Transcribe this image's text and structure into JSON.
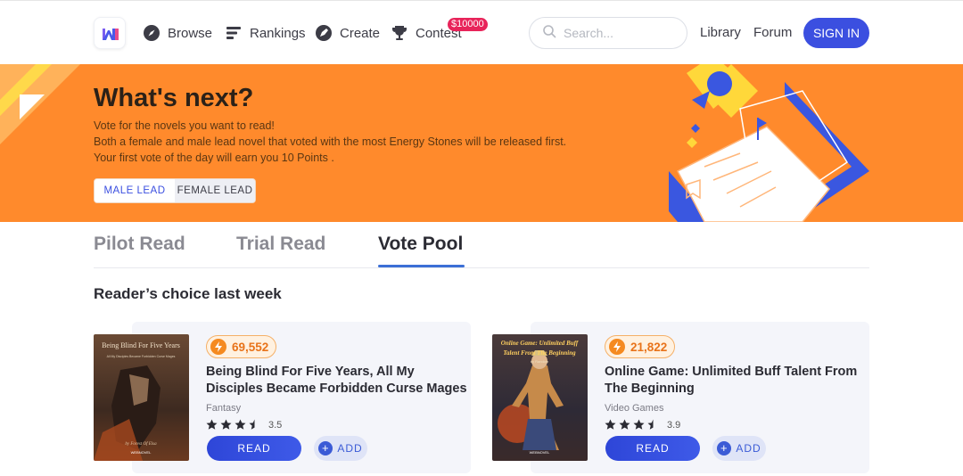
{
  "nav": {
    "browse": "Browse",
    "rankings": "Rankings",
    "create": "Create",
    "contest": "Contest",
    "contest_prize": "$10000",
    "search_placeholder": "Search...",
    "library": "Library",
    "forum": "Forum",
    "signin": "SIGN IN"
  },
  "banner": {
    "title": "What's next?",
    "line1": "Vote for the novels you want to read!",
    "line2": "Both a female and male lead novel that voted with the most Energy Stones will be released first.",
    "line3": "Your first vote of the day will earn you 10 Points .",
    "male_lead": "MALE LEAD",
    "female_lead": "FEMALE LEAD"
  },
  "tabs": {
    "pilot": "Pilot Read",
    "trial": "Trial Read",
    "vote": "Vote Pool"
  },
  "section_title": "Reader’s choice last week",
  "books": [
    {
      "votes": "69,552",
      "title_line1": "Being Blind For Five Years, All My",
      "title_line2": "Disciples Became Forbidden Curse Mages",
      "genre": "Fantasy",
      "rating": "3.5",
      "read": "READ",
      "add": "ADD",
      "cover_title": "Being Blind For Five Years",
      "cover_subtitle": "All My Disciples Became Forbidden Curse Mages",
      "cover_author": "by Forest Of Elsa",
      "cover_brand": "WEBNOVEL"
    },
    {
      "votes": "21,822",
      "title_line1": "Online Game: Unlimited Buff Talent From",
      "title_line2": "The Beginning",
      "genre": "Video Games",
      "rating": "3.9",
      "read": "READ",
      "add": "ADD",
      "cover_title": "Online Game: Unlimited Buff",
      "cover_subtitle": "Talent From The Beginning",
      "cover_author": "by Random",
      "cover_brand": "WEBNOVEL"
    }
  ],
  "colors": {
    "accent": "#3b4fe0",
    "banner": "#ff8a2c",
    "votes": "#e8731a",
    "badge": "#e8245a"
  },
  "icons": {
    "logo": "webnovel-logo-icon",
    "browse": "compass-icon",
    "rankings": "list-bars-icon",
    "create": "pen-icon",
    "contest": "trophy-icon",
    "search": "search-icon",
    "votes": "bolt-icon",
    "star": "star-icon",
    "add": "plus-icon"
  }
}
